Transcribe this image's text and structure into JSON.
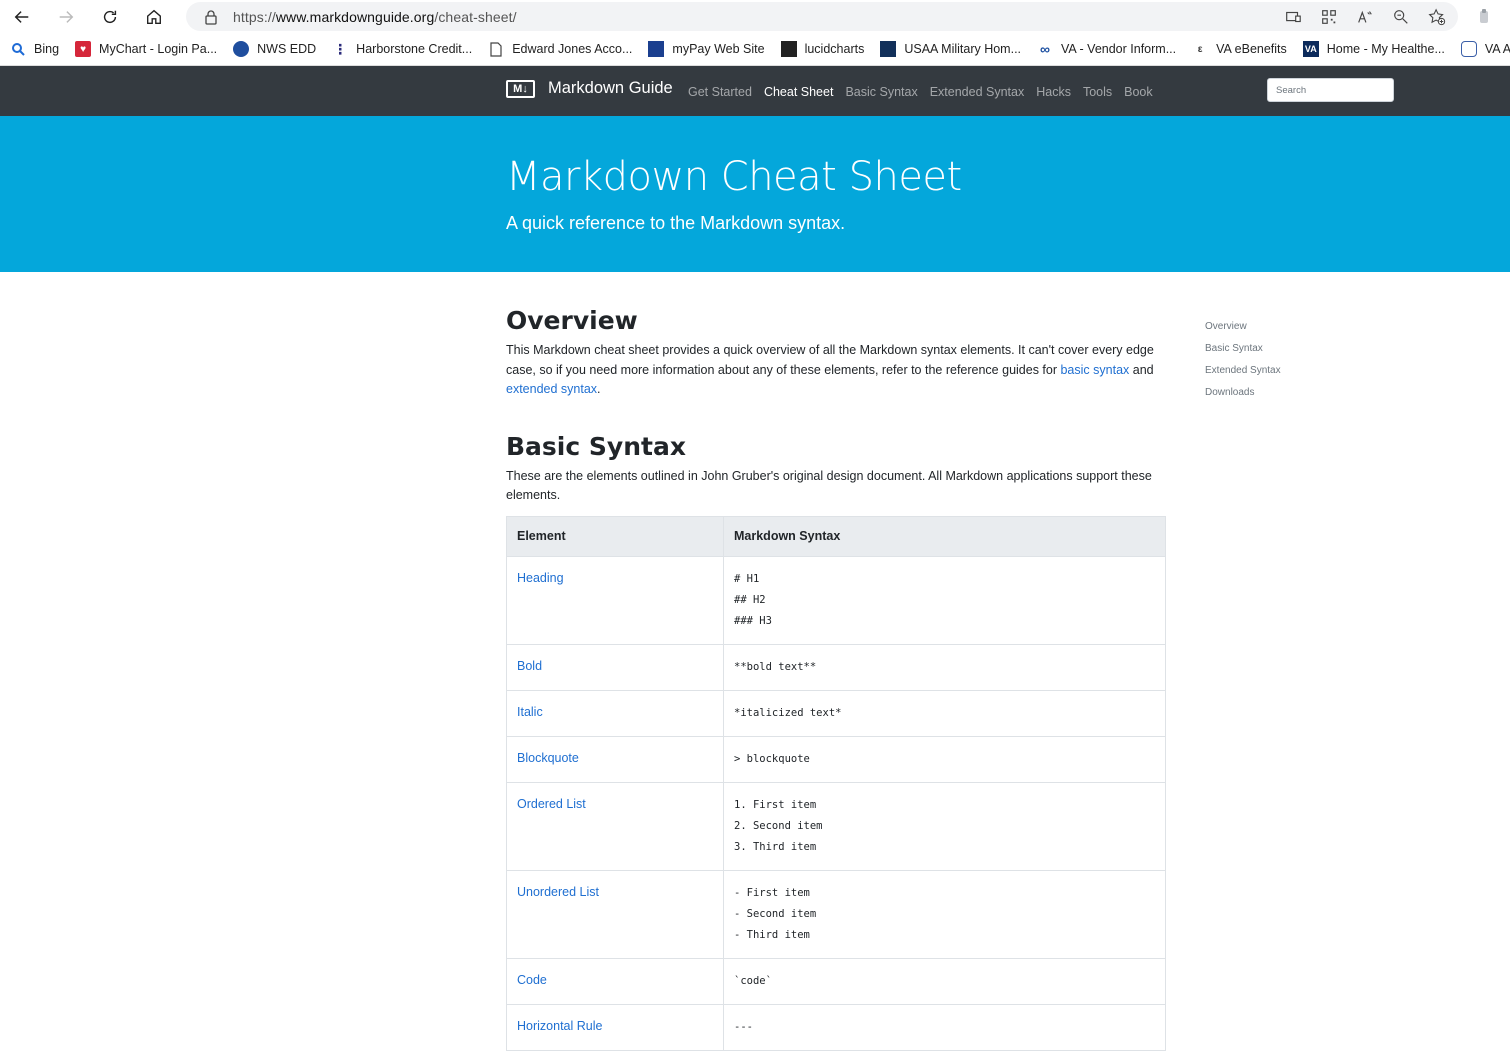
{
  "browser": {
    "url_scheme": "https://",
    "url_host": "www.markdownguide.org",
    "url_path": "/cheat-sheet/",
    "bookmarks": [
      {
        "label": "Bing",
        "icon": "search-icon",
        "color": "#1e6bd6"
      },
      {
        "label": "MyChart - Login Pa...",
        "icon": "mychart-icon",
        "color": "#d5263a"
      },
      {
        "label": "NWS EDD",
        "icon": "noaa-icon",
        "color": "#1f4e9e"
      },
      {
        "label": "Harborstone Credit...",
        "icon": "harborstone-icon",
        "color": "#2a2a7a"
      },
      {
        "label": "Edward Jones Acco...",
        "icon": "page-icon",
        "color": "#555555"
      },
      {
        "label": "myPay Web Site",
        "icon": "mypay-icon",
        "color": "#1b3f8f"
      },
      {
        "label": "lucidcharts",
        "icon": "lucid-icon",
        "color": "#222222"
      },
      {
        "label": "USAA Military Hom...",
        "icon": "usaa-icon",
        "color": "#12305a"
      },
      {
        "label": "VA - Vendor Inform...",
        "icon": "va-vendor-icon",
        "color": "#1c4fa1"
      },
      {
        "label": "VA eBenefits",
        "icon": "ebenefits-icon",
        "color": "#333333"
      },
      {
        "label": "Home - My Healthe...",
        "icon": "va-icon",
        "color": "#0b2a5b"
      },
      {
        "label": "VA Access Gatew",
        "icon": "access-icon",
        "color": "#3b5fa8"
      }
    ]
  },
  "site": {
    "brand_logo": "M↓",
    "brand_name": "Markdown Guide",
    "nav": [
      "Get Started",
      "Cheat Sheet",
      "Basic Syntax",
      "Extended Syntax",
      "Hacks",
      "Tools",
      "Book"
    ],
    "search_placeholder": "Search"
  },
  "hero": {
    "title": "Markdown Cheat Sheet",
    "subtitle": "A quick reference to the Markdown syntax."
  },
  "overview": {
    "heading": "Overview",
    "text_1": "This Markdown cheat sheet provides a quick overview of all the Markdown syntax elements. It can't cover every edge case, so if you need more information about any of these elements, refer to the reference guides for ",
    "link_1": "basic syntax",
    "text_2": " and ",
    "link_2": "extended syntax",
    "text_3": "."
  },
  "basic": {
    "heading": "Basic Syntax",
    "text": "These are the elements outlined in John Gruber's original design document. All Markdown applications support these elements.",
    "col_element": "Element",
    "col_syntax": "Markdown Syntax",
    "rows": [
      {
        "element": "Heading",
        "syntax": [
          "# H1",
          "## H2",
          "### H3"
        ]
      },
      {
        "element": "Bold",
        "syntax": [
          "**bold text**"
        ]
      },
      {
        "element": "Italic",
        "syntax": [
          "*italicized text*"
        ]
      },
      {
        "element": "Blockquote",
        "syntax": [
          "> blockquote"
        ]
      },
      {
        "element": "Ordered List",
        "syntax": [
          "1. First item",
          "2. Second item",
          "3. Third item"
        ]
      },
      {
        "element": "Unordered List",
        "syntax": [
          "- First item",
          "- Second item",
          "- Third item"
        ]
      },
      {
        "element": "Code",
        "syntax": [
          "`code`"
        ]
      },
      {
        "element": "Horizontal Rule",
        "syntax": [
          "---"
        ]
      }
    ]
  },
  "toc": [
    "Overview",
    "Basic Syntax",
    "Extended Syntax",
    "Downloads"
  ]
}
